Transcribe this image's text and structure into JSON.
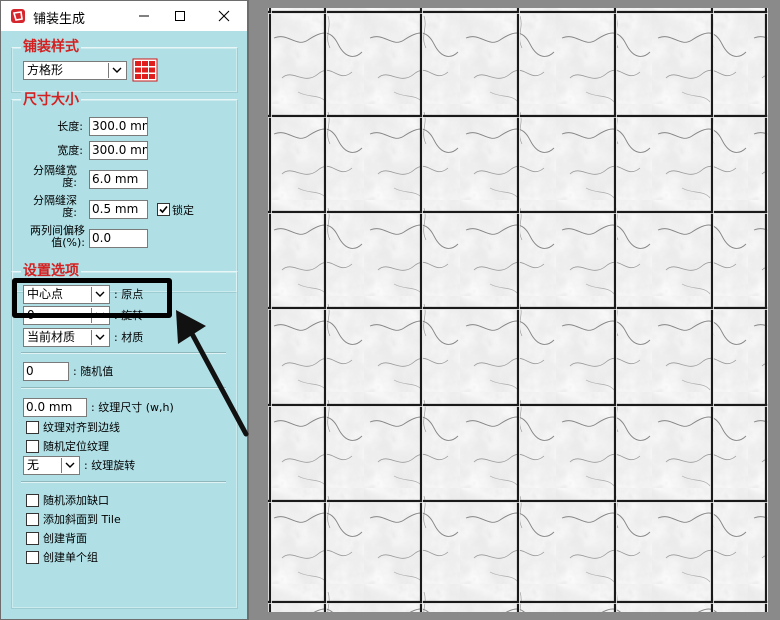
{
  "window": {
    "title": "铺装生成",
    "minimize_icon": "minimize-icon",
    "maximize_icon": "maximize-icon",
    "close_icon": "close-icon"
  },
  "style_group": {
    "title": "铺装样式",
    "pattern": "方格形",
    "pattern_icon": "grid-pattern-icon"
  },
  "size_group": {
    "title": "尺寸大小",
    "length_label": "长度:",
    "length_value": "300.0 mm",
    "width_label": "宽度:",
    "width_value": "300.0 mm",
    "gap_width_label": "分隔缝宽度:",
    "gap_width_value": "6.0 mm",
    "gap_depth_label": "分隔缝深度:",
    "gap_depth_value": "0.5 mm",
    "lock_label": "锁定",
    "lock_checked": true,
    "offset_label": "两列间偏移值(%):",
    "offset_value": "0.0"
  },
  "settings_group": {
    "title": "设置选项",
    "origin_value": "中心点",
    "origin_label": ": 原点",
    "rotation_value": "0",
    "rotation_label": ": 旋转",
    "material_value": "当前材质",
    "material_label": ": 材质",
    "random_value": "0",
    "random_label": ": 随机值",
    "texture_size_value": "0.0 mm",
    "texture_size_label": ": 纹理尺寸 (w,h)",
    "align_edge_label": "纹理对齐到边线",
    "random_position_label": "随机定位纹理",
    "texture_rotation_value": "无",
    "texture_rotation_label": ": 纹理旋转",
    "random_gap_label": "随机添加缺口",
    "add_bevel_label": "添加斜面到 Tile",
    "create_back_label": "创建背面",
    "create_group_label": "创建单个组"
  },
  "colors": {
    "panel_bg": "#b0e0e6",
    "group_title": "#d42020",
    "grout": "#1a1a1a",
    "marble": "#e6e6e6"
  },
  "preview": {
    "rows": 6,
    "cols": 5,
    "material": "marble"
  },
  "annotation": {
    "arrow_icon": "black-arrow-icon"
  }
}
